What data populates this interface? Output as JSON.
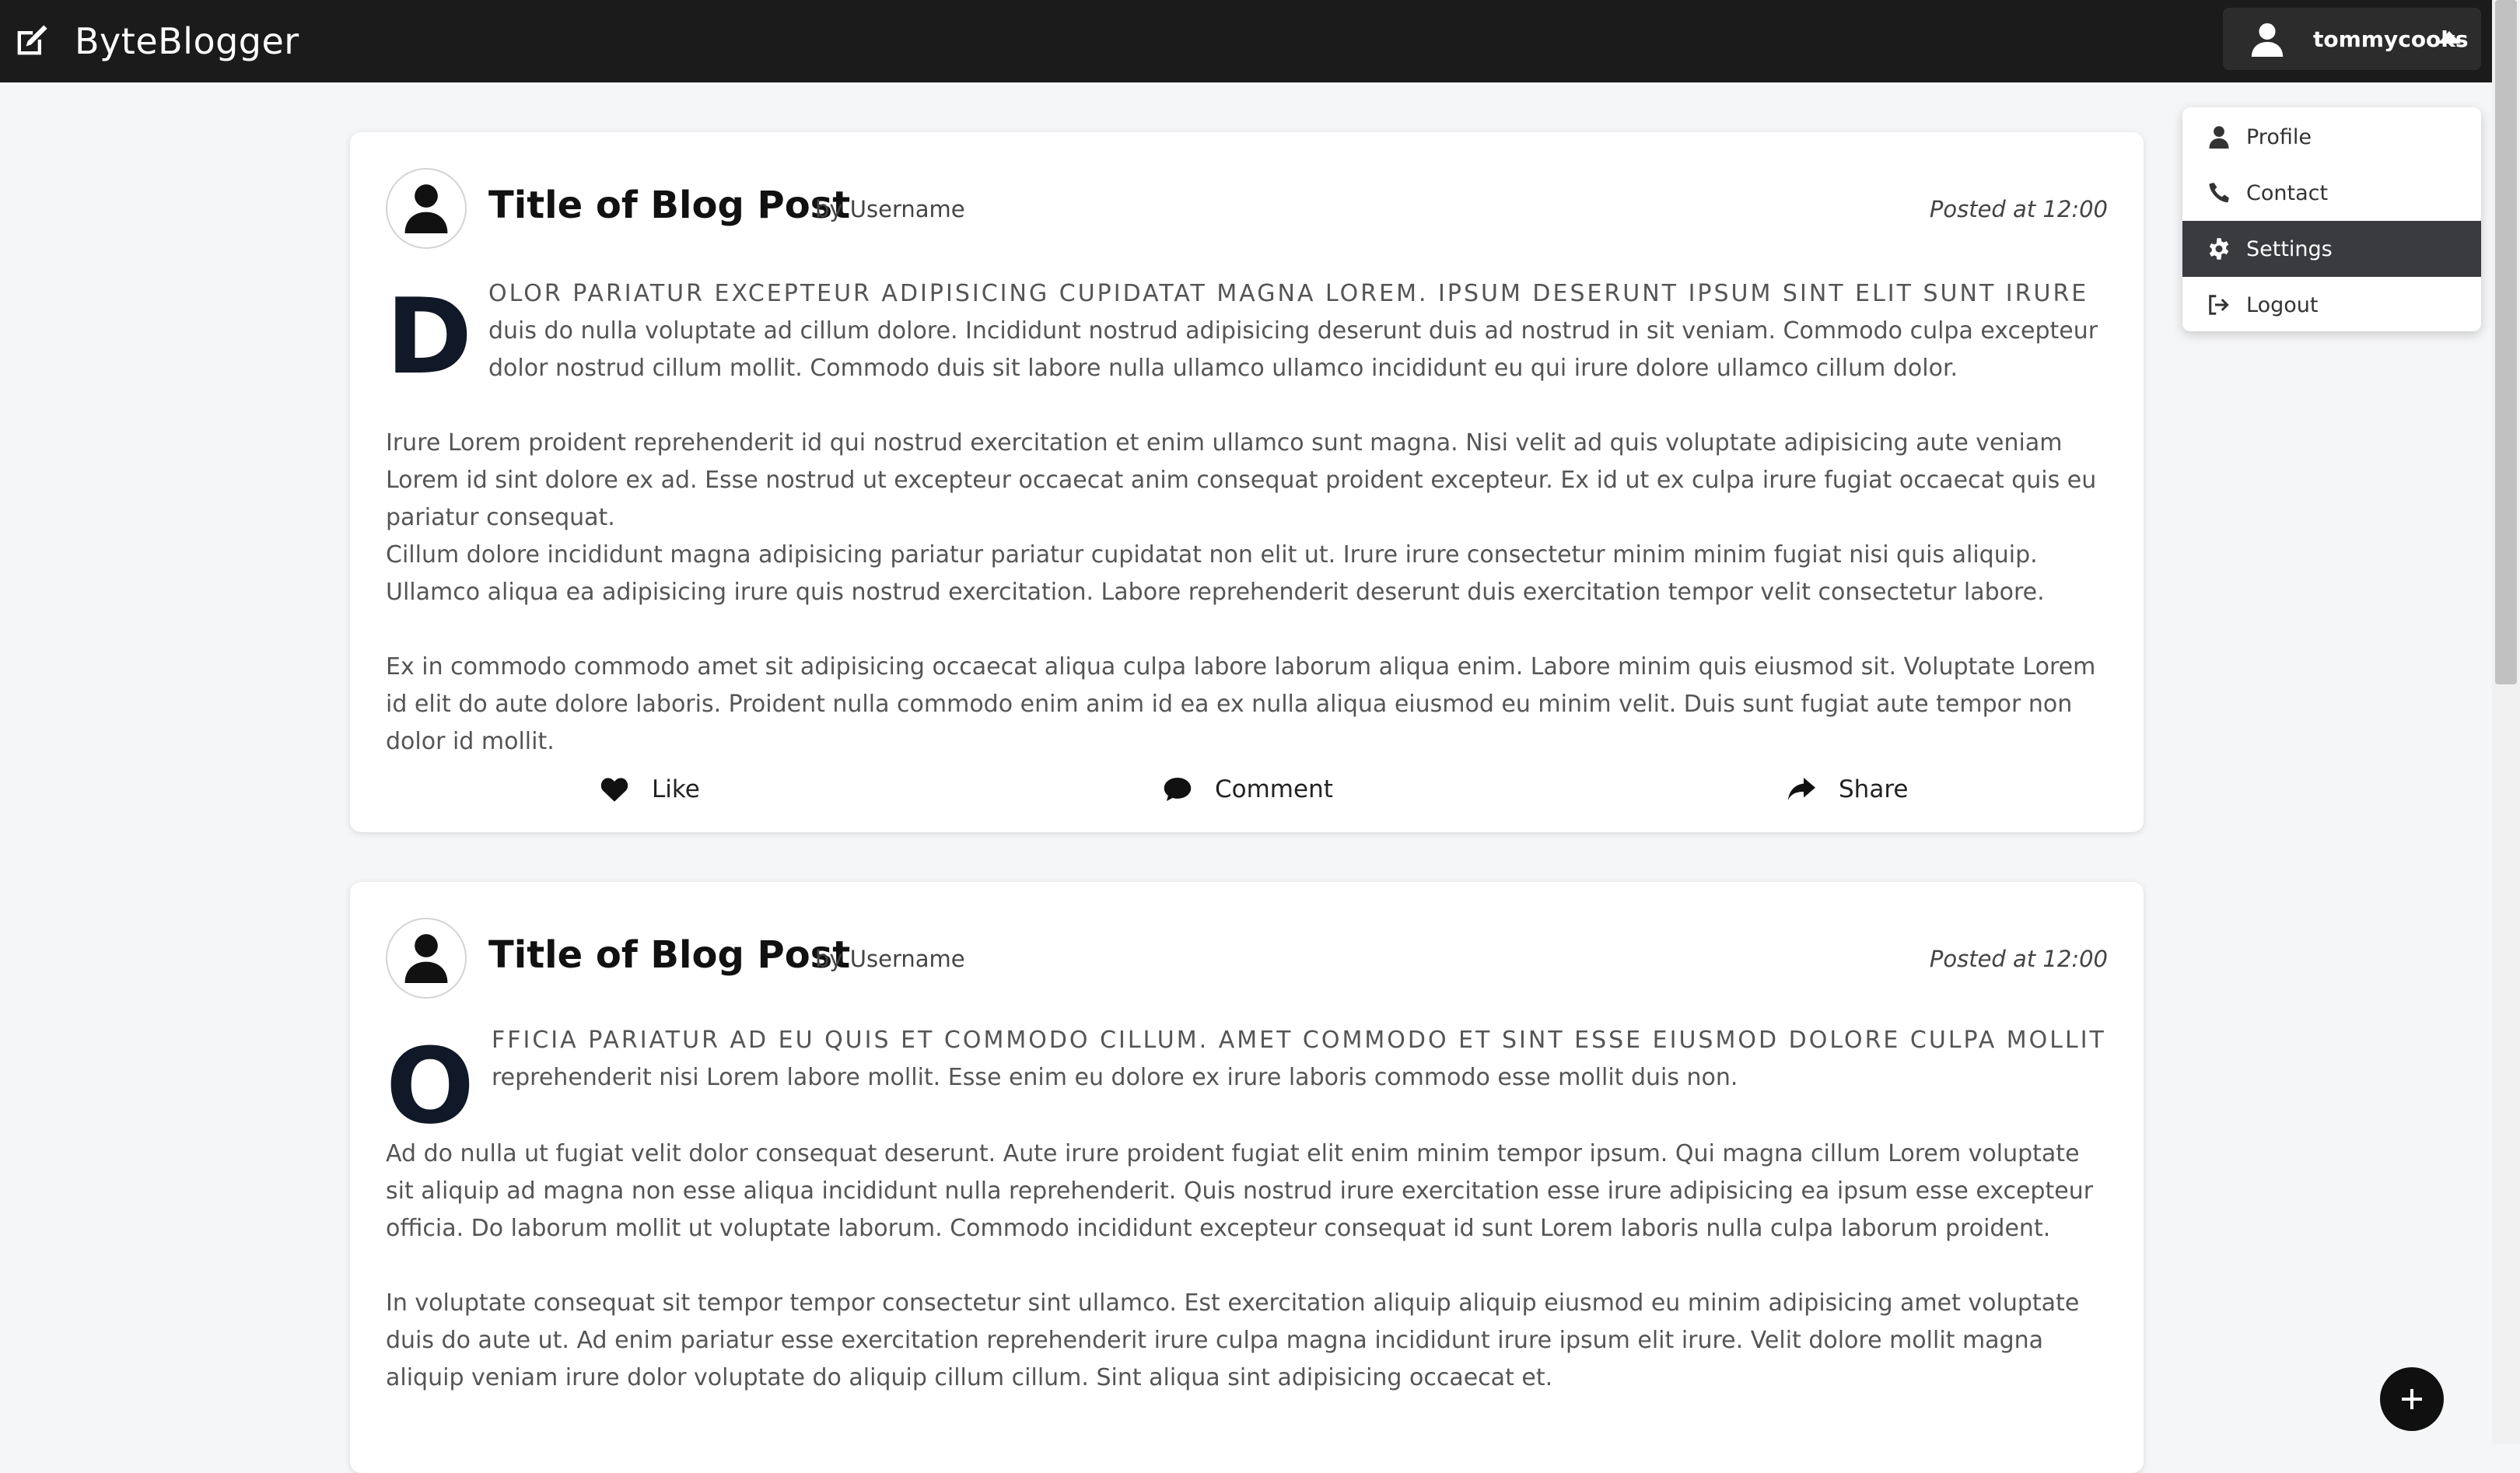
{
  "app": {
    "name": "ByteBlogger"
  },
  "user": {
    "username": "tommycooks"
  },
  "user_menu": {
    "items": [
      {
        "label": "Profile",
        "icon": "user-icon"
      },
      {
        "label": "Contact",
        "icon": "phone-icon"
      },
      {
        "label": "Settings",
        "icon": "gear-icon",
        "active": true
      },
      {
        "label": "Logout",
        "icon": "logout-icon"
      }
    ]
  },
  "posts": [
    {
      "title": "Title of Blog Post",
      "author": "by Username",
      "time": "Posted at 12:00",
      "dropcap": "D",
      "lead_caps": "olor pariatur excepteur adipisicing cupidatat magna lorem. Ipsum deserunt ipsum sint elit sunt irure",
      "lead_rest": "duis do nulla voluptate ad cillum dolore. Incididunt nostrud adipisicing deserunt duis ad nostrud in sit veniam. Commodo culpa excepteur dolor nostrud cillum mollit. Commodo duis sit labore nulla ullamco ullamco incididunt eu qui irure dolore ullamco cillum dolor.",
      "paragraphs": [
        "Irure Lorem proident reprehenderit id qui nostrud exercitation et enim ullamco sunt magna. Nisi velit ad quis voluptate adipisicing aute veniam Lorem id sint dolore ex ad. Esse nostrud ut excepteur occaecat anim consequat proident excepteur. Ex id ut ex culpa irure fugiat occaecat quis eu pariatur consequat.",
        "Cillum dolore incididunt magna adipisicing pariatur pariatur cupidatat non elit ut. Irure irure consectetur minim minim fugiat nisi quis aliquip. Ullamco aliqua ea adipisicing irure quis nostrud exercitation. Labore reprehenderit deserunt duis exercitation tempor velit consectetur labore.",
        "Ex in commodo commodo amet sit adipisicing occaecat aliqua culpa labore laborum aliqua enim. Labore minim quis eiusmod sit. Voluptate Lorem id elit do aute dolore laboris. Proident nulla commodo enim anim id ea ex nulla aliqua eiusmod eu minim velit. Duis sunt fugiat aute tempor non dolor id mollit."
      ],
      "actions": {
        "like": "Like",
        "comment": "Comment",
        "share": "Share"
      }
    },
    {
      "title": "Title of Blog Post",
      "author": "by Username",
      "time": "Posted at 12:00",
      "dropcap": "O",
      "lead_caps": "fficia pariatur ad eu quis et commodo cillum. Amet commodo et sint esse eiusmod dolore culpa mollit",
      "lead_rest": "reprehenderit nisi Lorem labore mollit. Esse enim eu dolore ex irure laboris commodo esse mollit duis non.",
      "paragraphs": [
        "Ad do nulla ut fugiat velit dolor consequat deserunt. Aute irure proident fugiat elit enim minim tempor ipsum. Qui magna cillum Lorem voluptate sit aliquip ad magna non esse aliqua incididunt nulla reprehenderit. Quis nostrud irure exercitation esse irure adipisicing ea ipsum esse excepteur officia. Do laborum mollit ut voluptate laborum. Commodo incididunt excepteur consequat id sunt Lorem laboris nulla culpa laborum proident.",
        "In voluptate consequat sit tempor tempor consectetur sint ullamco. Est exercitation aliquip aliquip eiusmod eu minim adipisicing amet voluptate duis do aute ut. Ad enim pariatur esse exercitation reprehenderit irure culpa magna incididunt irure ipsum elit irure. Velit dolore mollit magna aliquip veniam irure dolor voluptate do aliquip cillum cillum. Sint aliqua sint adipisicing occaecat et."
      ]
    }
  ]
}
